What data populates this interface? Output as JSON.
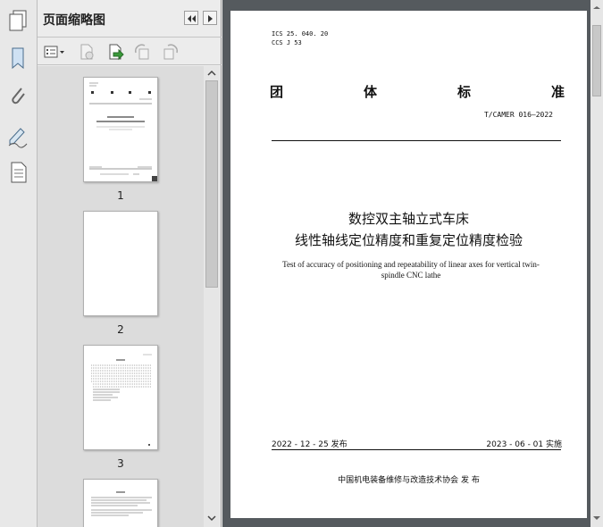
{
  "panel": {
    "title": "页面缩略图"
  },
  "thumbnails": [
    {
      "label": "1"
    },
    {
      "label": "2"
    },
    {
      "label": "3"
    }
  ],
  "document": {
    "ics": "ICS  25. 040. 20",
    "ccs": "CCS  J 53",
    "standard_chars": [
      "团",
      "体",
      "标",
      "准"
    ],
    "code": "T/CAMER 016—2022",
    "title_line1": "数控双主轴立式车床",
    "title_line2": "线性轴线定位精度和重复定位精度检验",
    "title_en_line1": "Test of accuracy of positioning and repeatability of linear axes for vertical twin-",
    "title_en_line2": "spindle CNC lathe",
    "publish_date": "2022 - 12 - 25 发布",
    "implement_date": "2023 - 06 - 01 实施",
    "publisher": "中国机电装备维修与改造技术协会    发  布"
  }
}
